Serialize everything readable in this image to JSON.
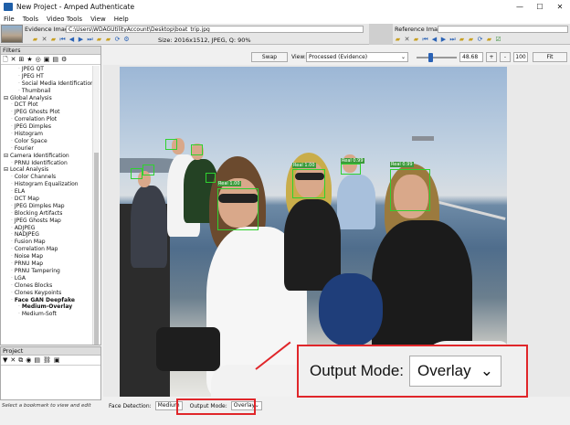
{
  "window": {
    "title": "New Project - Amped Authenticate",
    "minimize": "—",
    "maximize": "☐",
    "close": "✕"
  },
  "menu": [
    "File",
    "Tools",
    "Video Tools",
    "View",
    "Help"
  ],
  "evidence": {
    "label": "Evidence Image:",
    "path": "C:\\Users\\WDAGUtilityAccount\\Desktop\\boat_trip.jpg",
    "size_info": "Size: 2016x1512, JPEG, Q: 90%"
  },
  "reference": {
    "label": "Reference Image:"
  },
  "filters_panel": {
    "header": "Filters",
    "items": [
      {
        "label": "JPEG QT",
        "level": 2
      },
      {
        "label": "JPEG HT",
        "level": 2
      },
      {
        "label": "Social Media Identification",
        "level": 2
      },
      {
        "label": "Thumbnail",
        "level": 2
      },
      {
        "label": "Global Analysis",
        "level": 0
      },
      {
        "label": "DCT Plot",
        "level": 1
      },
      {
        "label": "JPEG Ghosts Plot",
        "level": 1
      },
      {
        "label": "Correlation Plot",
        "level": 1
      },
      {
        "label": "JPEG Dimples",
        "level": 1
      },
      {
        "label": "Histogram",
        "level": 1
      },
      {
        "label": "Color Space",
        "level": 1
      },
      {
        "label": "Fourier",
        "level": 1
      },
      {
        "label": "Camera Identification",
        "level": 0
      },
      {
        "label": "PRNU Identification",
        "level": 1
      },
      {
        "label": "Local Analysis",
        "level": 0
      },
      {
        "label": "Color Channels",
        "level": 1
      },
      {
        "label": "Histogram Equalization",
        "level": 1
      },
      {
        "label": "ELA",
        "level": 1
      },
      {
        "label": "DCT Map",
        "level": 1
      },
      {
        "label": "JPEG Dimples Map",
        "level": 1
      },
      {
        "label": "Blocking Artifacts",
        "level": 1
      },
      {
        "label": "JPEG Ghosts Map",
        "level": 1
      },
      {
        "label": "ADJPEG",
        "level": 1
      },
      {
        "label": "NADJPEG",
        "level": 1
      },
      {
        "label": "Fusion Map",
        "level": 1
      },
      {
        "label": "Correlation Map",
        "level": 1
      },
      {
        "label": "Noise Map",
        "level": 1
      },
      {
        "label": "PRNU Map",
        "level": 1
      },
      {
        "label": "PRNU Tampering",
        "level": 1
      },
      {
        "label": "LGA",
        "level": 1
      },
      {
        "label": "Clones Blocks",
        "level": 1
      },
      {
        "label": "Clones Keypoints",
        "level": 1
      },
      {
        "label": "Face GAN Deepfake",
        "level": 1,
        "bold": true
      },
      {
        "label": "Medium-Overlay",
        "level": 2,
        "bold": true
      },
      {
        "label": "Medium-Soft",
        "level": 2
      }
    ]
  },
  "project_panel": {
    "header": "Project"
  },
  "status_left": "Select a bookmark to view and edit",
  "viewer_toolbar": {
    "swap": "Swap",
    "view_label": "View:",
    "view_value": "Processed (Evidence)",
    "zoom_value": "48.68",
    "plus": "+",
    "minus": "-",
    "zoom_100": "100",
    "fit": "Fit",
    "slider_level": 0.35
  },
  "faces": [
    {
      "label": "Real 1.00"
    },
    {
      "label": "Real 1.00"
    },
    {
      "label": "Real 0.99"
    },
    {
      "label": "Real 0.99"
    }
  ],
  "bottom": {
    "face_detection_label": "Face Detection:",
    "face_detection_value": "Medium",
    "output_mode_label": "Output Mode:",
    "output_mode_value": "Overlay"
  },
  "callout": {
    "label": "Output Mode:",
    "value": "Overlay",
    "chevron": "⌄"
  },
  "colors": {
    "highlight": "#e0262a",
    "face_box": "#2fd12f"
  }
}
